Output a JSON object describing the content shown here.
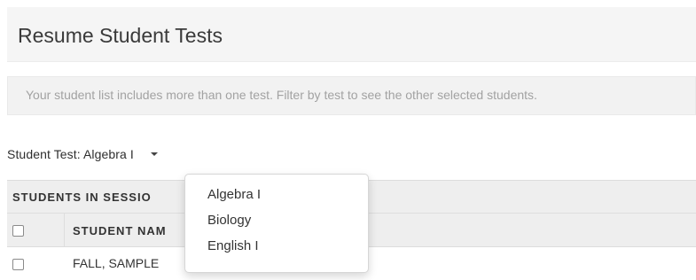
{
  "page": {
    "title": "Resume Student Tests"
  },
  "info": {
    "message": "Your student list includes more than one test. Filter by test to see the other selected students."
  },
  "test_selector": {
    "label": "Student Test: Algebra I"
  },
  "dropdown": {
    "options": [
      "Algebra I",
      "Biology",
      "English I"
    ]
  },
  "table": {
    "session_header": "STUDENTS IN SESSIO",
    "columns": {
      "student_name": "STUDENT NAM"
    },
    "rows": [
      {
        "student_name": "FALL, SAMPLE"
      }
    ]
  }
}
